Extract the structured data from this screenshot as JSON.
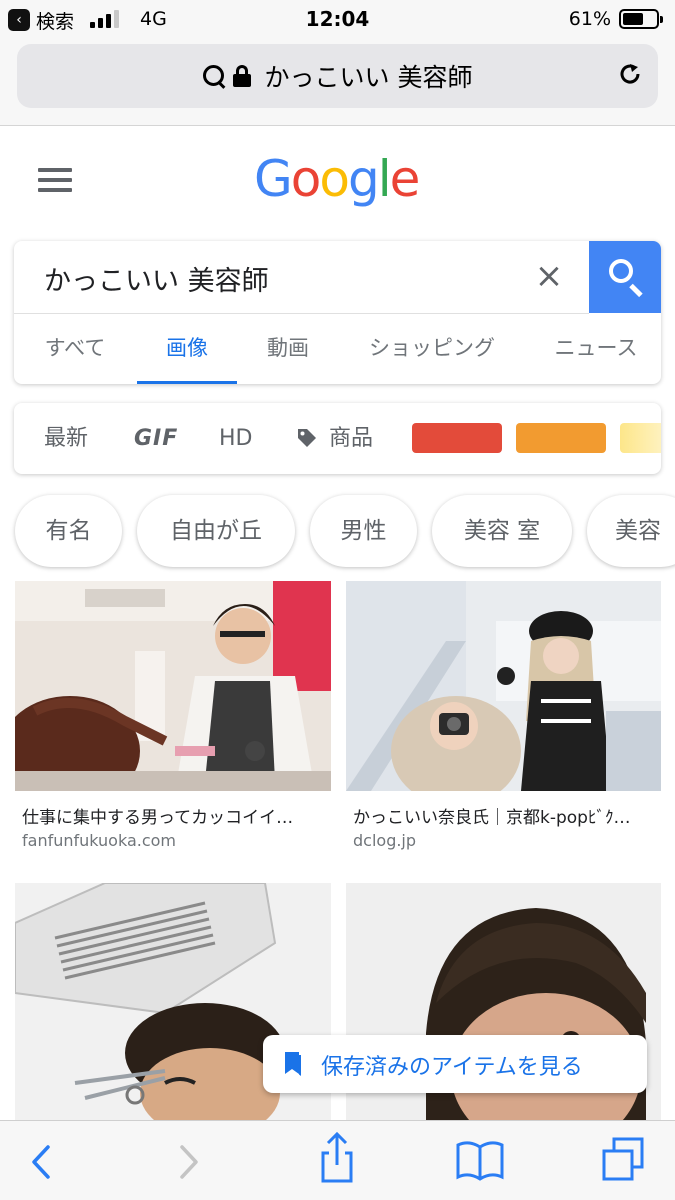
{
  "status_bar": {
    "back_app": "検索",
    "network": "4G",
    "time": "12:04",
    "battery": "61%",
    "battery_level": 0.61
  },
  "address_bar": {
    "url_text": "かっこいい 美容師"
  },
  "header": {
    "logo_letters": [
      "G",
      "o",
      "o",
      "g",
      "l",
      "e"
    ],
    "logo_colors": [
      "#4285f4",
      "#ea4335",
      "#fbbc05",
      "#4285f4",
      "#34a853",
      "#ea4335"
    ]
  },
  "search": {
    "query": "かっこいい 美容師",
    "tabs": [
      "すべて",
      "画像",
      "動画",
      "ショッピング",
      "ニュース"
    ],
    "active_tab": "画像"
  },
  "filters": {
    "items": [
      "最新",
      "GIF",
      "HD",
      "商品"
    ],
    "color_swatches": [
      "#e34b3a",
      "#f29b30",
      "#fde68a"
    ]
  },
  "chips": [
    "有名",
    "自由が丘",
    "男性",
    "美容 室",
    "美容"
  ],
  "results": [
    {
      "caption": "仕事に集中する男ってカッコイイ…",
      "source": "fanfunfukuoka.com"
    },
    {
      "caption": "かっこいい奈良氏｜京都k-popﾋﾞｸ…",
      "source": "dclog.jp"
    }
  ],
  "saved_items": {
    "label": "保存済みのアイテムを見る"
  },
  "colors": {
    "accent": "#1a73e8",
    "search_button": "#4285f4"
  }
}
